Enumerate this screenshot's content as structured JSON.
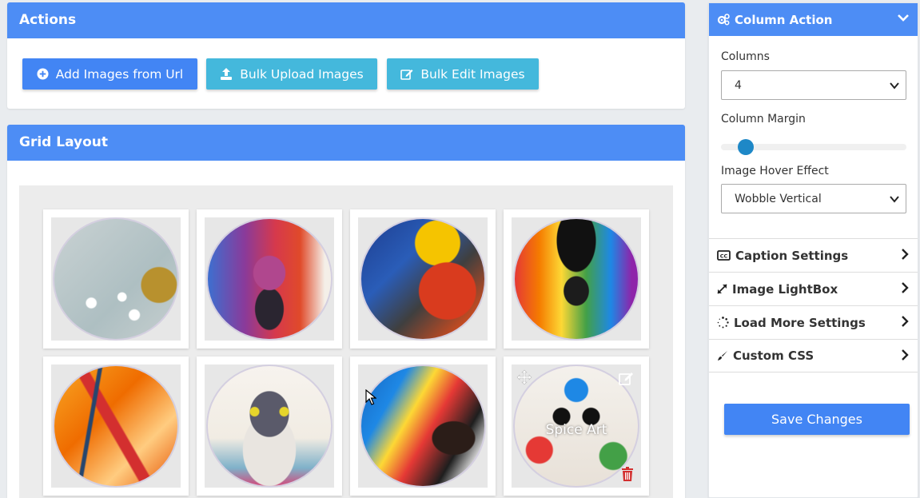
{
  "actions": {
    "title": "Actions",
    "buttons": {
      "add_url": "Add Images from Url",
      "bulk_upload": "Bulk Upload Images",
      "bulk_edit": "Bulk Edit Images"
    }
  },
  "grid": {
    "title": "Grid Layout",
    "images": [
      {
        "name": "dogs-and-fish-painting"
      },
      {
        "name": "colorful-elephant-painting"
      },
      {
        "name": "peacock-woman-painting"
      },
      {
        "name": "rain-umbrella-girl-painting"
      },
      {
        "name": "abstract-orange-painting"
      },
      {
        "name": "watercolor-cat-painting"
      },
      {
        "name": "woman-painting-wall"
      },
      {
        "name": "splatter-cat-painting",
        "caption": "Spice Art"
      }
    ]
  },
  "sidebar": {
    "column_action": {
      "title": "Column Action",
      "columns_label": "Columns",
      "columns_value": "4",
      "margin_label": "Column Margin",
      "margin_value": 0.1,
      "hover_label": "Image Hover Effect",
      "hover_value": "Wobble Vertical"
    },
    "sections": [
      {
        "label": "Caption Settings",
        "icon": "closed-caption-icon"
      },
      {
        "label": "Image LightBox",
        "icon": "expand-icon"
      },
      {
        "label": "Load More Settings",
        "icon": "spinner-icon"
      },
      {
        "label": "Custom CSS",
        "icon": "paintbrush-icon"
      }
    ],
    "save_label": "Save Changes"
  },
  "colors": {
    "header_blue": "#4d8df5",
    "button_blue": "#4285f4",
    "button_cyan": "#44b8dc",
    "slider_thumb": "#1e88c7"
  }
}
